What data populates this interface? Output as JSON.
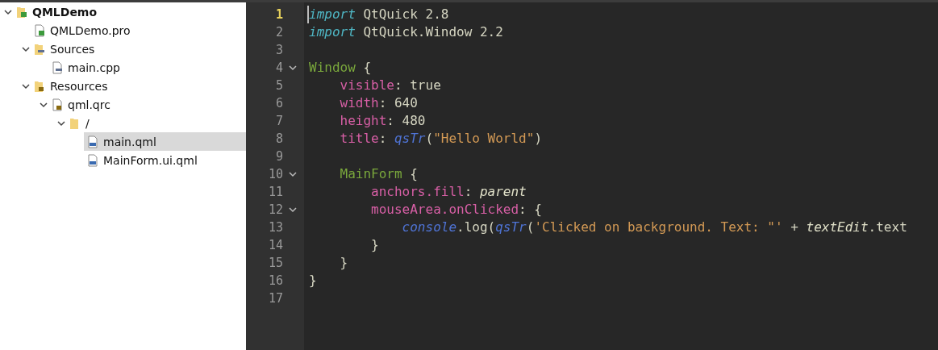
{
  "project_tree": {
    "items": [
      {
        "label": "QMLDemo",
        "kind": "project",
        "expanded": true,
        "selected": false,
        "children": [
          {
            "label": "QMLDemo.pro",
            "kind": "pro",
            "selected": false
          },
          {
            "label": "Sources",
            "kind": "sources",
            "expanded": true,
            "selected": false,
            "children": [
              {
                "label": "main.cpp",
                "kind": "cpp",
                "selected": false
              }
            ]
          },
          {
            "label": "Resources",
            "kind": "resources",
            "expanded": true,
            "selected": false,
            "children": [
              {
                "label": "qml.qrc",
                "kind": "qrc",
                "expanded": true,
                "selected": false,
                "children": [
                  {
                    "label": "/",
                    "kind": "folder",
                    "expanded": true,
                    "selected": false,
                    "children": [
                      {
                        "label": "main.qml",
                        "kind": "qml",
                        "selected": true
                      },
                      {
                        "label": "MainForm.ui.qml",
                        "kind": "qml",
                        "selected": false
                      }
                    ]
                  }
                ]
              }
            ]
          }
        ]
      }
    ]
  },
  "editor": {
    "lines": [
      {
        "number": "1",
        "current": true,
        "fold": false,
        "tokens": [
          {
            "text": "import",
            "kind": "keyword"
          },
          {
            "text": " QtQuick 2.8",
            "kind": "plain"
          }
        ]
      },
      {
        "number": "2",
        "current": false,
        "fold": false,
        "tokens": [
          {
            "text": "import",
            "kind": "keyword"
          },
          {
            "text": " QtQuick.Window 2.2",
            "kind": "plain"
          }
        ]
      },
      {
        "number": "3",
        "current": false,
        "fold": false
      },
      {
        "number": "4",
        "current": false,
        "fold": true,
        "tokens": [
          {
            "text": "Window",
            "kind": "type"
          },
          {
            "text": " {",
            "kind": "plain"
          }
        ]
      },
      {
        "number": "5",
        "current": false,
        "fold": false,
        "tokens": [
          {
            "text": "    visible",
            "kind": "prop"
          },
          {
            "text": ": true",
            "kind": "plain"
          }
        ]
      },
      {
        "number": "6",
        "current": false,
        "fold": false,
        "tokens": [
          {
            "text": "    width",
            "kind": "prop"
          },
          {
            "text": ": 640",
            "kind": "plain"
          }
        ]
      },
      {
        "number": "7",
        "current": false,
        "fold": false,
        "tokens": [
          {
            "text": "    height",
            "kind": "prop"
          },
          {
            "text": ": 480",
            "kind": "plain"
          }
        ]
      },
      {
        "number": "8",
        "current": false,
        "fold": false,
        "tokens": [
          {
            "text": "    title",
            "kind": "prop"
          },
          {
            "text": ": ",
            "kind": "plain"
          },
          {
            "text": "qsTr",
            "kind": "func"
          },
          {
            "text": "(",
            "kind": "plain"
          },
          {
            "text": "\"Hello World\"",
            "kind": "string"
          },
          {
            "text": ")",
            "kind": "plain"
          }
        ]
      },
      {
        "number": "9",
        "current": false,
        "fold": false
      },
      {
        "number": "10",
        "current": false,
        "fold": true,
        "tokens": [
          {
            "text": "    MainForm",
            "kind": "type"
          },
          {
            "text": " {",
            "kind": "plain"
          }
        ]
      },
      {
        "number": "11",
        "current": false,
        "fold": false,
        "tokens": [
          {
            "text": "        anchors.fill",
            "kind": "prop"
          },
          {
            "text": ": ",
            "kind": "plain"
          },
          {
            "text": "parent",
            "kind": "ident"
          }
        ]
      },
      {
        "number": "12",
        "current": false,
        "fold": true,
        "tokens": [
          {
            "text": "        mouseArea.onClicked",
            "kind": "prop"
          },
          {
            "text": ": {",
            "kind": "plain"
          }
        ]
      },
      {
        "number": "13",
        "current": false,
        "fold": false,
        "tokens": [
          {
            "text": "            console",
            "kind": "func"
          },
          {
            "text": ".log(",
            "kind": "plain"
          },
          {
            "text": "qsTr",
            "kind": "func"
          },
          {
            "text": "(",
            "kind": "plain"
          },
          {
            "text": "'Clicked on background. Text: \"'",
            "kind": "string"
          },
          {
            "text": " + ",
            "kind": "plain"
          },
          {
            "text": "textEdit",
            "kind": "ident"
          },
          {
            "text": ".text",
            "kind": "plain"
          }
        ]
      },
      {
        "number": "14",
        "current": false,
        "fold": false,
        "tokens": [
          {
            "text": "        }",
            "kind": "plain"
          }
        ]
      },
      {
        "number": "15",
        "current": false,
        "fold": false,
        "tokens": [
          {
            "text": "    }",
            "kind": "plain"
          }
        ]
      },
      {
        "number": "16",
        "current": false,
        "fold": false,
        "tokens": [
          {
            "text": "}",
            "kind": "plain"
          }
        ]
      },
      {
        "number": "17",
        "current": false,
        "fold": false
      }
    ]
  }
}
